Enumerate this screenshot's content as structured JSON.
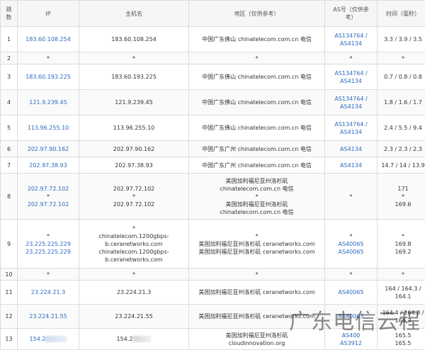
{
  "headers": {
    "hop": "跳\n数",
    "ip": "IP",
    "host": "主机名",
    "location": "地区（仅供参考）",
    "as": "AS号（仅供参\n考）",
    "time": "时间（毫秒）"
  },
  "rows": [
    {
      "hop": "1",
      "ip": [
        "183.60.108.254"
      ],
      "host": [
        "183.60.108.254"
      ],
      "loc": [
        "中国广东佛山 chinatelecom.com.cn 电信"
      ],
      "as": [
        "AS134764 /",
        "AS4134"
      ],
      "time": [
        "3.3 / 3.9 / 3.5"
      ]
    },
    {
      "hop": "2",
      "ip": [
        "*"
      ],
      "host": [
        "*"
      ],
      "loc": [
        "*"
      ],
      "as": [
        "*"
      ],
      "time": [
        "*"
      ]
    },
    {
      "hop": "3",
      "ip": [
        "183.60.193.225"
      ],
      "host": [
        "183.60.193.225"
      ],
      "loc": [
        "中国广东佛山 chinatelecom.com.cn 电信"
      ],
      "as": [
        "AS134764 /",
        "AS4134"
      ],
      "time": [
        "0.7 / 0.8 / 0.8"
      ]
    },
    {
      "hop": "4",
      "ip": [
        "121.9.239.45"
      ],
      "host": [
        "121.9.239.45"
      ],
      "loc": [
        "中国广东佛山 chinatelecom.com.cn 电信"
      ],
      "as": [
        "AS134764 /",
        "AS4134"
      ],
      "time": [
        "1.8 / 1.6 / 1.7"
      ]
    },
    {
      "hop": "5",
      "ip": [
        "113.96.255.10"
      ],
      "host": [
        "113.96.255.10"
      ],
      "loc": [
        "中国广东佛山 chinatelecom.com.cn 电信"
      ],
      "as": [
        "AS134764 /",
        "AS4134"
      ],
      "time": [
        "2.4 / 5.5 / 9.4"
      ]
    },
    {
      "hop": "6",
      "ip": [
        "202.97.90.162"
      ],
      "host": [
        "202.97.90.162"
      ],
      "loc": [
        "中国广东广州 chinatelecom.com.cn 电信"
      ],
      "as": [
        "AS4134"
      ],
      "time": [
        "2.3 / 2.3 / 2.3"
      ]
    },
    {
      "hop": "7",
      "ip": [
        "202.97.38.93"
      ],
      "host": [
        "202.97.38.93"
      ],
      "loc": [
        "中国广东广州 chinatelecom.com.cn 电信"
      ],
      "as": [
        "AS4134"
      ],
      "time": [
        "14.7 / 14 / 13.9"
      ]
    },
    {
      "hop": "8",
      "ip": [
        "202.97.72.102",
        "*",
        "202.97.72.102"
      ],
      "host": [
        "202.97.72.102",
        "*",
        "202.97.72.102"
      ],
      "loc": [
        "美国加利福尼亚州洛杉矶",
        "chinatelecom.com.cn 电信",
        "*",
        "美国加利福尼亚州洛杉矶",
        "chinatelecom.com.cn 电信"
      ],
      "as": [
        "*"
      ],
      "time": [
        "171",
        "*",
        "169.6"
      ]
    },
    {
      "hop": "9",
      "ip": [
        "*",
        "23.225.225.229",
        "23.225.225.229"
      ],
      "host": [
        "*",
        "chinatelecom.1200gbps-",
        "b.ceranetworks.com",
        "chinatelecom.1200gbps-",
        "b.ceranetworks.com"
      ],
      "loc": [
        "*",
        "美国加利福尼亚州洛杉矶 ceranetworks.com",
        "美国加利福尼亚州洛杉矶 ceranetworks.com"
      ],
      "as": [
        "*",
        "AS40065",
        "AS40065"
      ],
      "time": [
        "*",
        "169.8",
        "169.2"
      ]
    },
    {
      "hop": "10",
      "ip": [
        "*"
      ],
      "host": [
        "*"
      ],
      "loc": [
        "*"
      ],
      "as": [
        "*"
      ],
      "time": [
        "*"
      ]
    },
    {
      "hop": "11",
      "ip": [
        "23.224.21.3"
      ],
      "host": [
        "23.224.21.3"
      ],
      "loc": [
        "美国加利福尼亚州洛杉矶 ceranetworks.com"
      ],
      "as": [
        "AS40065"
      ],
      "time": [
        "164 / 164.3 /",
        "164.1"
      ]
    },
    {
      "hop": "12",
      "ip": [
        "23.224.21.55"
      ],
      "host": [
        "23.224.21.55"
      ],
      "loc": [
        "美国加利福尼亚州洛杉矶 ceranetworks.com"
      ],
      "as": [
        "AS40065"
      ],
      "time": [
        "164.4 / 164.8 /",
        "164.3"
      ]
    },
    {
      "hop": "13",
      "ip": [
        "154.2"
      ],
      "host": [
        "154.2"
      ],
      "loc": [
        "美国加利福尼亚州洛杉矶",
        "cloudinnovation.org"
      ],
      "as": [
        "AS400",
        "AS3912"
      ],
      "time": [
        "165.5",
        "165.5"
      ]
    }
  ],
  "watermark": "广东电信云程"
}
